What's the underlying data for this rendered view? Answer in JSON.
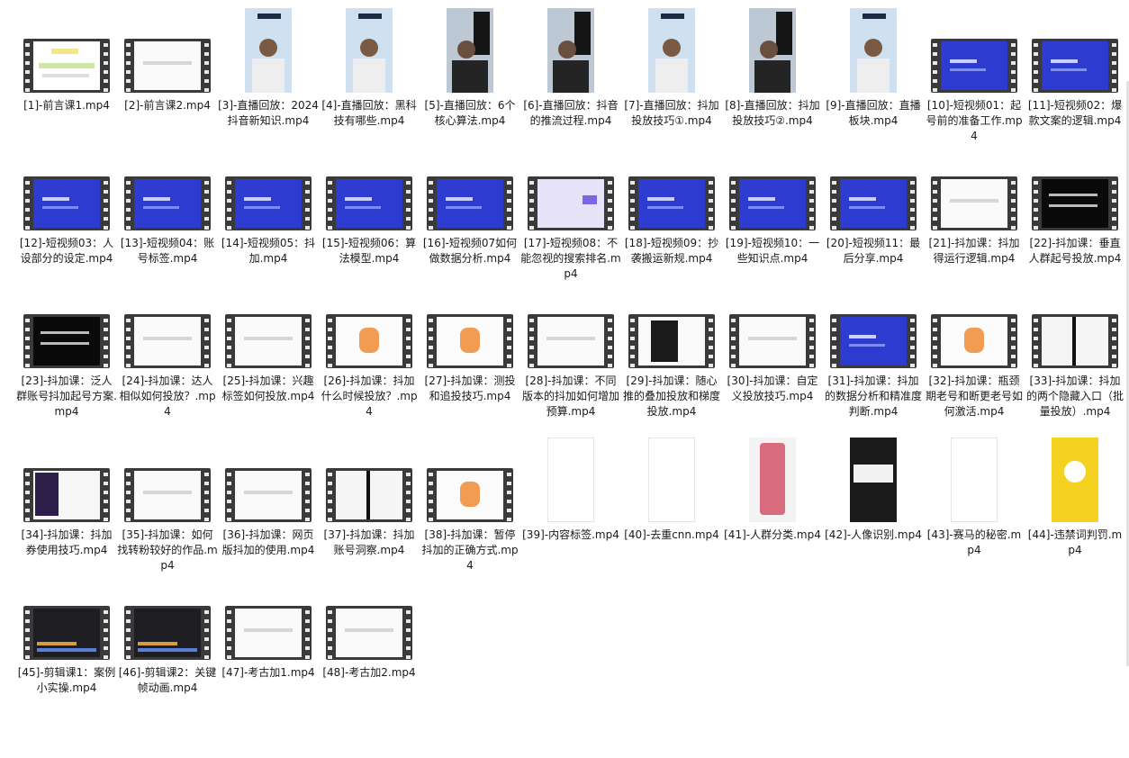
{
  "files": [
    {
      "label": "[1]-前言课1.mp4",
      "kind": "film",
      "scene": "diagram"
    },
    {
      "label": "[2]-前言课2.mp4",
      "kind": "film",
      "scene": "slide-white"
    },
    {
      "label": "[3]-直播回放：2024抖音新知识.mp4",
      "kind": "portrait",
      "scene": "person"
    },
    {
      "label": "[4]-直播回放：黑科技有哪些.mp4",
      "kind": "portrait",
      "scene": "person"
    },
    {
      "label": "[5]-直播回放：6个核心算法.mp4",
      "kind": "portrait",
      "scene": "person-dark"
    },
    {
      "label": "[6]-直播回放：抖音的推流过程.mp4",
      "kind": "portrait",
      "scene": "person-dark"
    },
    {
      "label": "[7]-直播回放：抖加投放技巧①.mp4",
      "kind": "portrait",
      "scene": "person"
    },
    {
      "label": "[8]-直播回放：抖加投放技巧②.mp4",
      "kind": "portrait",
      "scene": "person-dark"
    },
    {
      "label": "[9]-直播回放：直播板块.mp4",
      "kind": "portrait",
      "scene": "person"
    },
    {
      "label": "[10]-短视频01：起号前的准备工作.mp4",
      "kind": "film",
      "scene": "blue"
    },
    {
      "label": "[11]-短视频02：爆款文案的逻辑.mp4",
      "kind": "film",
      "scene": "blue"
    },
    {
      "label": "[12]-短视频03：人设部分的设定.mp4",
      "kind": "film",
      "scene": "blue"
    },
    {
      "label": "[13]-短视频04：账号标签.mp4",
      "kind": "film",
      "scene": "blue"
    },
    {
      "label": "[14]-短视频05：抖加.mp4",
      "kind": "film",
      "scene": "blue"
    },
    {
      "label": "[15]-短视频06：算法模型.mp4",
      "kind": "film",
      "scene": "blue"
    },
    {
      "label": "[16]-短视频07如何做数据分析.mp4",
      "kind": "film",
      "scene": "blue"
    },
    {
      "label": "[17]-短视频08：不能忽视的搜索排名.mp4",
      "kind": "film",
      "scene": "lavender"
    },
    {
      "label": "[18]-短视频09：抄袭搬运新规.mp4",
      "kind": "film",
      "scene": "blue"
    },
    {
      "label": "[19]-短视频10：一些知识点.mp4",
      "kind": "film",
      "scene": "blue"
    },
    {
      "label": "[20]-短视频11：最后分享.mp4",
      "kind": "film",
      "scene": "blue"
    },
    {
      "label": "[21]-抖加课：抖加得运行逻辑.mp4",
      "kind": "film",
      "scene": "slide-white"
    },
    {
      "label": "[22]-抖加课：垂直人群起号投放.mp4",
      "kind": "film",
      "scene": "black"
    },
    {
      "label": "[23]-抖加课：泛人群账号抖加起号方案.mp4",
      "kind": "film",
      "scene": "black"
    },
    {
      "label": "[24]-抖加课：达人相似如何投放？.mp4",
      "kind": "film",
      "scene": "slide-white"
    },
    {
      "label": "[25]-抖加课：兴趣标签如何投放.mp4",
      "kind": "film",
      "scene": "slide-white"
    },
    {
      "label": "[26]-抖加课：抖加什么时候投放？.mp4",
      "kind": "film",
      "scene": "illustration"
    },
    {
      "label": "[27]-抖加课：测投和追投技巧.mp4",
      "kind": "film",
      "scene": "illustration"
    },
    {
      "label": "[28]-抖加课：不同版本的抖加如何增加预算.mp4",
      "kind": "film",
      "scene": "slide-white"
    },
    {
      "label": "[29]-抖加课：随心推的叠加投放和梯度投放.mp4",
      "kind": "film",
      "scene": "phone"
    },
    {
      "label": "[30]-抖加课：自定义投放技巧.mp4",
      "kind": "film",
      "scene": "slide-white"
    },
    {
      "label": "[31]-抖加课：抖加的数据分析和精准度判断.mp4",
      "kind": "film",
      "scene": "blue"
    },
    {
      "label": "[32]-抖加课：瓶颈期老号和断更老号如何激活.mp4",
      "kind": "film",
      "scene": "illustration"
    },
    {
      "label": "[33]-抖加课：抖加的两个隐藏入口（批量投放）.mp4",
      "kind": "film",
      "scene": "black-stripe"
    },
    {
      "label": "[34]-抖加课：抖加券使用技巧.mp4",
      "kind": "film",
      "scene": "screen"
    },
    {
      "label": "[35]-抖加课：如何找转粉较好的作品.mp4",
      "kind": "film",
      "scene": "slide-white"
    },
    {
      "label": "[36]-抖加课：网页版抖加的使用.mp4",
      "kind": "film",
      "scene": "slide-white"
    },
    {
      "label": "[37]-抖加课：抖加账号洞察.mp4",
      "kind": "film",
      "scene": "black-stripe"
    },
    {
      "label": "[38]-抖加课：暂停抖加的正确方式.mp4",
      "kind": "film",
      "scene": "illustration"
    },
    {
      "label": "[39]-内容标签.mp4",
      "kind": "portrait",
      "scene": "white-doc"
    },
    {
      "label": "[40]-去重cnn.mp4",
      "kind": "portrait",
      "scene": "white-doc"
    },
    {
      "label": "[41]-人群分类.mp4",
      "kind": "portrait",
      "scene": "phone-pink"
    },
    {
      "label": "[42]-人像识别.mp4",
      "kind": "portrait",
      "scene": "dark-doc"
    },
    {
      "label": "[43]-赛马的秘密.mp4",
      "kind": "portrait",
      "scene": "white-doc"
    },
    {
      "label": "[44]-违禁词判罚.mp4",
      "kind": "portrait",
      "scene": "yellow"
    },
    {
      "label": "[45]-剪辑课1：案例小实操.mp4",
      "kind": "film",
      "scene": "editor"
    },
    {
      "label": "[46]-剪辑课2：关键帧动画.mp4",
      "kind": "film",
      "scene": "editor"
    },
    {
      "label": "[47]-考古加1.mp4",
      "kind": "film",
      "scene": "slide-white"
    },
    {
      "label": "[48]-考古加2.mp4",
      "kind": "film",
      "scene": "slide-white"
    }
  ]
}
